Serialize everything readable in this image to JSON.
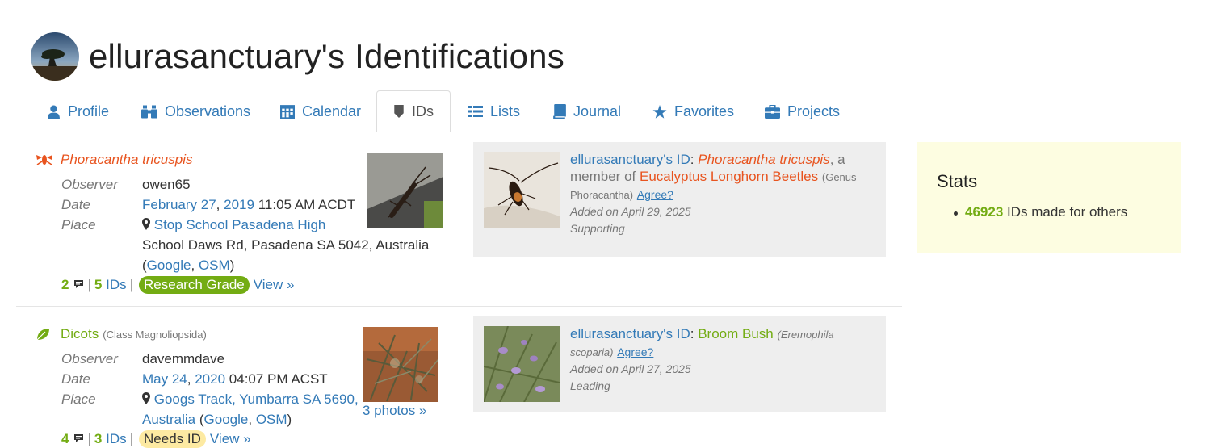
{
  "page": {
    "title": "ellurasanctuary's Identifications"
  },
  "tabs": [
    {
      "label": "Profile",
      "icon": "user-icon"
    },
    {
      "label": "Observations",
      "icon": "binoculars-icon"
    },
    {
      "label": "Calendar",
      "icon": "calendar-icon"
    },
    {
      "label": "IDs",
      "icon": "tag-icon",
      "active": true
    },
    {
      "label": "Lists",
      "icon": "list-icon"
    },
    {
      "label": "Journal",
      "icon": "book-icon"
    },
    {
      "label": "Favorites",
      "icon": "star-icon"
    },
    {
      "label": "Projects",
      "icon": "briefcase-icon"
    }
  ],
  "observations": [
    {
      "taxon": "Phoracantha tricuspis",
      "taxon_icon": "insect-icon",
      "labels": {
        "observer": "Observer",
        "date": "Date",
        "place": "Place"
      },
      "observer": "owen65",
      "date_link": "February 27",
      "date_sep": ",",
      "year_link": "2019",
      "time": "11:05 AM ACDT",
      "place_line1": "Stop School Pasadena High",
      "place_line2": "School Daws Rd, Pasadena SA 5042, Australia",
      "place_google": "Google",
      "place_osm": "OSM",
      "comments": "2",
      "ids": "5 IDs",
      "ids_num": "5",
      "ids_word": "IDs",
      "quality": "Research Grade",
      "view": "View »",
      "identification": {
        "user": "ellurasanctuary's ID",
        "taxon": "Phoracantha tricuspis",
        "member_text": ", a member of",
        "parent_common": "Eucalyptus Longhorn Beetles",
        "parent_sci": "(Genus Phoracantha)",
        "agree": "Agree?",
        "added": "Added on April 29, 2025",
        "category": "Supporting"
      }
    },
    {
      "taxon": "Dicots",
      "taxon_rank": "(Class Magnoliopsida)",
      "taxon_icon": "leaf-icon",
      "labels": {
        "observer": "Observer",
        "date": "Date",
        "place": "Place"
      },
      "observer": "davemmdave",
      "date_link": "May 24",
      "date_sep": ",",
      "year_link": "2020",
      "time": "04:07 PM ACST",
      "place_line1": "Googs Track, Yumbarra SA 5690,",
      "place_line2": "Australia",
      "place_google": "Google",
      "place_osm": "OSM",
      "photos": "3 photos »",
      "comments": "4",
      "ids_num": "3",
      "ids_word": "IDs",
      "quality": "Needs ID",
      "view": "View »",
      "identification": {
        "user": "ellurasanctuary's ID",
        "taxon": "Broom Bush",
        "taxon_sci_1": "(Eremophila",
        "taxon_sci_2": "scoparia)",
        "agree": "Agree?",
        "added": "Added on April 27, 2025",
        "category": "Leading"
      }
    }
  ],
  "stats": {
    "title": "Stats",
    "count": "46923",
    "label": "IDs made for others"
  },
  "colors": {
    "link": "#337ab7",
    "insect_taxon": "#e8541f",
    "plant_green": "#73ac13",
    "needs_id": "#fdeaa2",
    "stats_bg": "#fdfde1",
    "id_box_bg": "#eeeeee"
  }
}
